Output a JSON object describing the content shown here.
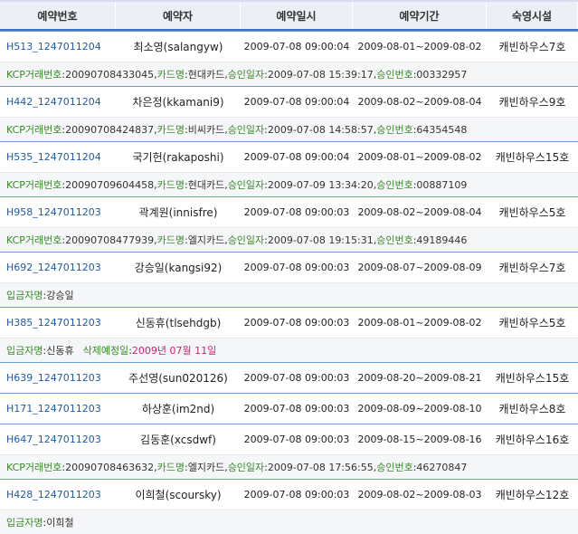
{
  "headers": [
    "예약번호",
    "예약자",
    "예약일시",
    "예약기간",
    "숙영시설"
  ],
  "labels": {
    "kcp": "KCP거래번호",
    "card": "카드명",
    "approval": "승인일자",
    "approval_no": "승인번호",
    "depositor": "입금자명",
    "delete_date": "삭제예정일"
  },
  "rows": [
    {
      "id": "H513_1247011204",
      "name": "최소영(salangyw)",
      "date": "2009-07-08 09:00:04",
      "period": "2009-08-01~2009-08-02",
      "facility": "캐빈하우스7호",
      "detail": {
        "type": "kcp",
        "kcp": "20090708433045",
        "card": "현대카드",
        "approval": "2009-07-08 15:39:17",
        "approval_no": "00332957"
      }
    },
    {
      "id": "H442_1247011204",
      "name": "차은정(kkamani9)",
      "date": "2009-07-08 09:00:04",
      "period": "2009-08-02~2009-08-04",
      "facility": "캐빈하우스9호",
      "detail": {
        "type": "kcp",
        "kcp": "20090708424837",
        "card": "비씨카드",
        "approval": "2009-07-08 14:58:57",
        "approval_no": "64354548"
      }
    },
    {
      "id": "H535_1247011204",
      "name": "국기헌(rakaposhi)",
      "date": "2009-07-08 09:00:04",
      "period": "2009-08-01~2009-08-02",
      "facility": "캐빈하우스15호",
      "detail": {
        "type": "kcp",
        "kcp": "20090709604458",
        "card": "현대카드",
        "approval": "2009-07-09 13:34:20",
        "approval_no": "00887109"
      }
    },
    {
      "id": "H958_1247011203",
      "name": "곽계원(innisfre)",
      "date": "2009-07-08 09:00:03",
      "period": "2009-08-02~2009-08-04",
      "facility": "캐빈하우스5호",
      "detail": {
        "type": "kcp",
        "kcp": "20090708477939",
        "card": "엘지카드",
        "approval": "2009-07-08 19:15:31",
        "approval_no": "49189446"
      }
    },
    {
      "id": "H692_1247011203",
      "name": "강승일(kangsi92)",
      "date": "2009-07-08 09:00:03",
      "period": "2009-08-07~2009-08-09",
      "facility": "캐빈하우스7호",
      "detail": {
        "type": "depositor",
        "depositor": "강승일"
      }
    },
    {
      "id": "H385_1247011203",
      "name": "신동휴(tlsehdgb)",
      "date": "2009-07-08 09:00:03",
      "period": "2009-08-01~2009-08-02",
      "facility": "캐빈하우스5호",
      "detail": {
        "type": "depositor_delete",
        "depositor": "신동휴",
        "delete_date": "2009년 07월 11일"
      }
    },
    {
      "id": "H639_1247011203",
      "name": "주선영(sun020126)",
      "date": "2009-07-08 09:00:03",
      "period": "2009-08-20~2009-08-21",
      "facility": "캐빈하우스15호",
      "detail": null
    },
    {
      "id": "H171_1247011203",
      "name": "하상훈(im2nd)",
      "date": "2009-07-08 09:00:03",
      "period": "2009-08-09~2009-08-10",
      "facility": "캐빈하우스8호",
      "detail": null
    },
    {
      "id": "H647_1247011203",
      "name": "김동훈(xcsdwf)",
      "date": "2009-07-08 09:00:03",
      "period": "2009-08-15~2009-08-16",
      "facility": "캐빈하우스16호",
      "detail": {
        "type": "kcp",
        "kcp": "20090708463632",
        "card": "엘지카드",
        "approval": "2009-07-08 17:56:55",
        "approval_no": "46270847"
      }
    },
    {
      "id": "H428_1247011203",
      "name": "이희철(scoursky)",
      "date": "2009-07-08 09:00:03",
      "period": "2009-08-02~2009-08-03",
      "facility": "캐빈하우스12호",
      "detail": {
        "type": "depositor",
        "depositor": "이희철"
      }
    }
  ]
}
